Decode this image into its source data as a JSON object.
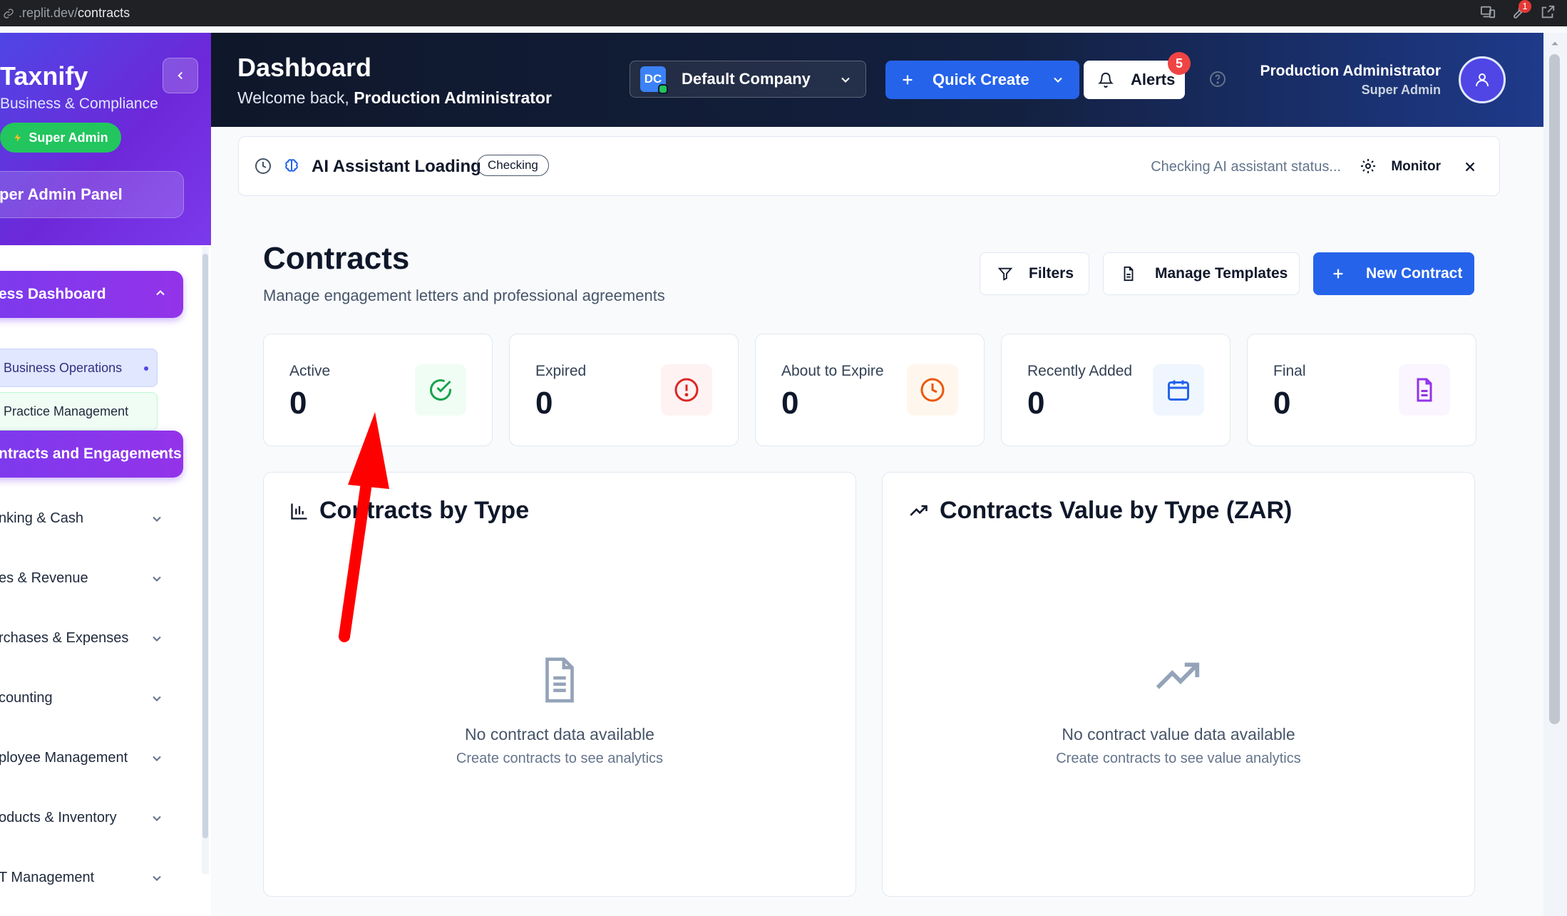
{
  "browser": {
    "url_prefix": ".replit.dev/",
    "url_path": "contracts",
    "tool_badge": "1"
  },
  "sidebar": {
    "brand": "Taxnify",
    "subtitle": "Business & Compliance",
    "role_badge": "Super Admin",
    "panel_label": "per Admin Panel",
    "active_group": "ess Dashboard",
    "sub_items": [
      "Business Operations",
      "Practice Management"
    ],
    "active_group_2": "ntracts and Engagements",
    "items": [
      "nking & Cash",
      "es & Revenue",
      "rchases & Expenses",
      "counting",
      "ployee Management",
      "oducts & Inventory",
      "T Management"
    ]
  },
  "header": {
    "title": "Dashboard",
    "welcome_prefix": "Welcome back,",
    "welcome_name": "Production Administrator",
    "company_initials": "DC",
    "company_name": "Default Company",
    "quick_create": "Quick Create",
    "alerts_label": "Alerts",
    "alerts_count": "5",
    "user_name": "Production Administrator",
    "user_role": "Super Admin"
  },
  "ai_banner": {
    "title": "AI Assistant Loading",
    "tag": "Checking",
    "status": "Checking AI assistant status...",
    "monitor": "Monitor"
  },
  "contracts": {
    "title": "Contracts",
    "subtitle": "Manage engagement letters and professional agreements",
    "filters": "Filters",
    "manage_templates": "Manage Templates",
    "new_contract": "New Contract"
  },
  "stats": [
    {
      "label": "Active",
      "value": "0",
      "icon": "check-circle-icon",
      "color": "#16a34a",
      "bg": "#f0fdf4"
    },
    {
      "label": "Expired",
      "value": "0",
      "icon": "alert-circle-icon",
      "color": "#dc2626",
      "bg": "#fef2f2"
    },
    {
      "label": "About to Expire",
      "value": "0",
      "icon": "clock-icon",
      "color": "#ea580c",
      "bg": "#fff7ed"
    },
    {
      "label": "Recently Added",
      "value": "0",
      "icon": "calendar-icon",
      "color": "#2563eb",
      "bg": "#eff6ff"
    },
    {
      "label": "Final",
      "value": "0",
      "icon": "file-icon",
      "color": "#9333ea",
      "bg": "#faf5ff"
    }
  ],
  "panels": {
    "by_type": {
      "title": "Contracts by Type",
      "empty_title": "No contract data available",
      "empty_sub": "Create contracts to see analytics"
    },
    "value_by_type": {
      "title": "Contracts Value by Type (ZAR)",
      "empty_title": "No contract value data available",
      "empty_sub": "Create contracts to see value analytics"
    }
  },
  "colors": {
    "primary": "#2563eb",
    "sidebar_gradient_start": "#4f46e5",
    "sidebar_gradient_end": "#7c3aed",
    "header_dark": "#0f172a",
    "annotation_arrow": "#ff0000"
  }
}
